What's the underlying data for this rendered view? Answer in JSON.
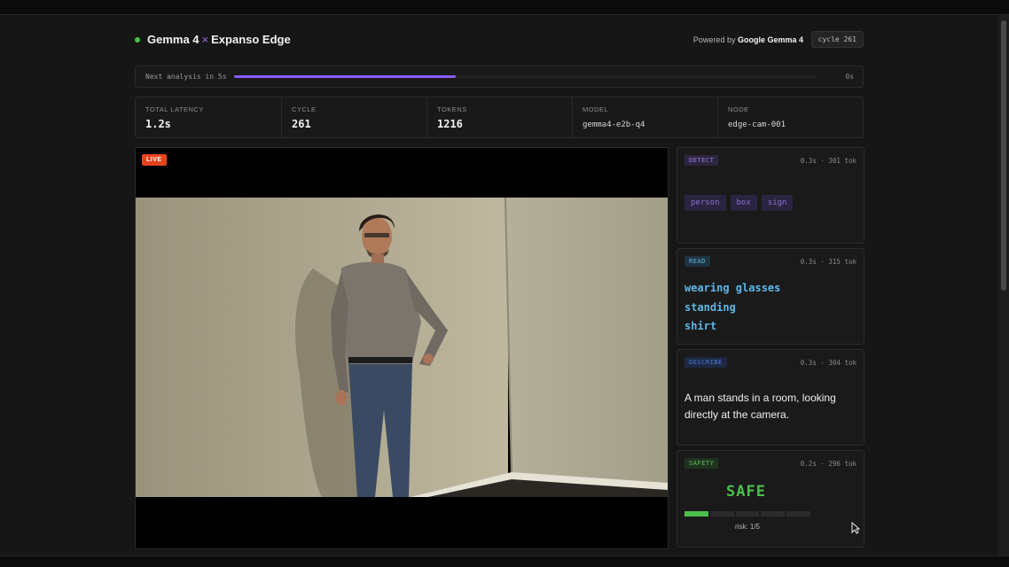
{
  "header": {
    "brand_left": "Gemma 4",
    "brand_sep": "×",
    "brand_right": "Expanso Edge",
    "powered_prefix": "Powered by",
    "powered_name": "Google Gemma 4",
    "cycle_pill": "cycle 261"
  },
  "next_analysis": {
    "label": "Next analysis in 5s",
    "progress": 0.38,
    "end_label": "0s",
    "accent": "#8b5cf6"
  },
  "stats": [
    {
      "label": "Total latency",
      "value": "1.2s"
    },
    {
      "label": "Cycle",
      "value": "261"
    },
    {
      "label": "Tokens",
      "value": "1216"
    },
    {
      "label": "Model",
      "value": "gemma4-e2b-q4"
    },
    {
      "label": "Node",
      "value": "edge-cam-001"
    }
  ],
  "video": {
    "live_badge": "LIVE"
  },
  "cards": {
    "detect": {
      "tag": "DETECT",
      "meta": "0.3s · 301 tok",
      "chips": [
        "person",
        "box",
        "sign"
      ]
    },
    "read": {
      "tag": "READ",
      "meta": "0.3s · 315 tok",
      "items": [
        "wearing glasses",
        "standing",
        "shirt"
      ]
    },
    "describe": {
      "tag": "DESCRIBE",
      "meta": "0.3s · 304 tok",
      "text": "A man stands in a room, looking directly at the camera."
    },
    "safety": {
      "tag": "SAFETY",
      "meta": "0.2s · 296 tok",
      "status": "SAFE",
      "risk_level": 1,
      "risk_max": 5,
      "risk_label": "risk: 1/5",
      "color": "#4cc04c"
    }
  }
}
